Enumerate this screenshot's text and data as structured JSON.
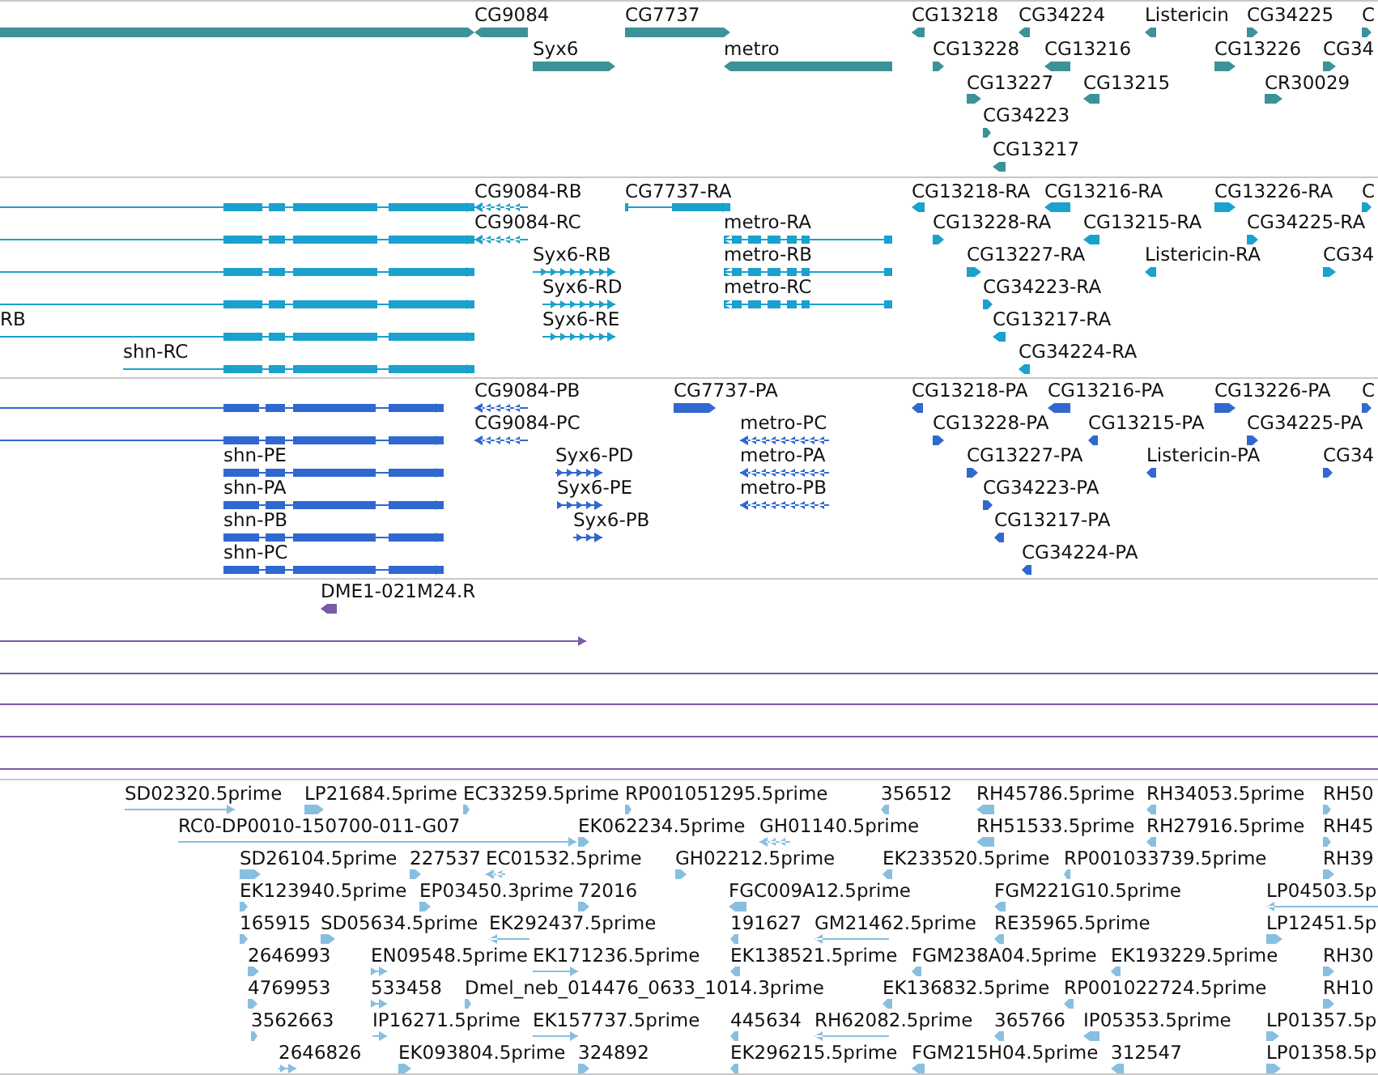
{
  "tracks": [
    {
      "color": "#3c9299",
      "features": [
        {
          "kind": "forward"
        },
        {
          "label": "CG9084",
          "kind": "reverse"
        },
        {
          "label": "CG7737",
          "kind": "forward"
        },
        {
          "label": "CG13218",
          "kind": "reverse"
        },
        {
          "label": "CG34224",
          "kind": "reverse"
        },
        {
          "label": "Listericin",
          "kind": "reverse"
        },
        {
          "label": "CG34225",
          "kind": "forward"
        },
        {
          "label": "C",
          "kind": "forward"
        },
        {
          "label": "Syx6",
          "kind": "forward"
        },
        {
          "label": "metro",
          "kind": "reverse"
        },
        {
          "label": "CG13228",
          "kind": "forward"
        },
        {
          "label": "CG13216",
          "kind": "reverse"
        },
        {
          "label": "CG13226",
          "kind": "forward"
        },
        {
          "label": "CG34",
          "kind": "forward"
        },
        {
          "label": "CG13227",
          "kind": "forward"
        },
        {
          "label": "CG13215",
          "kind": "reverse"
        },
        {
          "label": "CR30029",
          "kind": "forward"
        },
        {
          "label": "CG34223",
          "kind": "forward"
        },
        {
          "label": "CG13217",
          "kind": "reverse"
        }
      ]
    },
    {
      "color": "#1ba1cd",
      "features": [
        {
          "kind": "forward"
        },
        {
          "label": "CG9084-RB",
          "kind": "reverse"
        },
        {
          "label": "CG7737-RA",
          "kind": "forward"
        },
        {
          "label": "CG13218-RA",
          "kind": "reverse"
        },
        {
          "label": "CG13216-RA",
          "kind": "reverse"
        },
        {
          "label": "CG13226-RA",
          "kind": "forward"
        },
        {
          "label": "C",
          "kind": "forward"
        },
        {
          "kind": "forward"
        },
        {
          "label": "CG9084-RC",
          "kind": "reverse"
        },
        {
          "label": "metro-RA",
          "kind": "reverse"
        },
        {
          "label": "CG13228-RA",
          "kind": "forward"
        },
        {
          "label": "CG13215-RA",
          "kind": "reverse"
        },
        {
          "label": "CG34225-RA",
          "kind": "forward"
        },
        {
          "kind": "forward"
        },
        {
          "label": "Syx6-RB",
          "kind": "forward"
        },
        {
          "label": "metro-RB",
          "kind": "reverse"
        },
        {
          "label": "CG13227-RA",
          "kind": "forward"
        },
        {
          "label": "Listericin-RA",
          "kind": "reverse"
        },
        {
          "label": "CG34",
          "kind": "forward"
        },
        {
          "kind": "forward"
        },
        {
          "label": "Syx6-RD",
          "kind": "forward"
        },
        {
          "label": "metro-RC",
          "kind": "reverse"
        },
        {
          "label": "CG34223-RA",
          "kind": "forward"
        },
        {
          "label": "RB",
          "kind": "forward"
        },
        {
          "label": "Syx6-RE",
          "kind": "forward"
        },
        {
          "label": "CG13217-RA",
          "kind": "reverse"
        },
        {
          "label": "shn-RC",
          "kind": "forward"
        },
        {
          "label": "CG34224-RA",
          "kind": "reverse"
        }
      ]
    },
    {
      "color": "#3068d0",
      "features": [
        {
          "kind": "forward"
        },
        {
          "label": "CG9084-PB",
          "kind": "reverse"
        },
        {
          "label": "CG7737-PA",
          "kind": "forward"
        },
        {
          "label": "CG13218-PA",
          "kind": "reverse"
        },
        {
          "label": "CG13216-PA",
          "kind": "reverse"
        },
        {
          "label": "CG13226-PA",
          "kind": "forward"
        },
        {
          "label": "C",
          "kind": "forward"
        },
        {
          "kind": "forward"
        },
        {
          "label": "CG9084-PC",
          "kind": "reverse"
        },
        {
          "label": "metro-PC",
          "kind": "reverse"
        },
        {
          "label": "CG13228-PA",
          "kind": "forward"
        },
        {
          "label": "CG13215-PA",
          "kind": "reverse"
        },
        {
          "label": "CG34225-PA",
          "kind": "forward"
        },
        {
          "label": "shn-PE",
          "kind": "forward"
        },
        {
          "label": "Syx6-PD",
          "kind": "forward"
        },
        {
          "label": "metro-PA",
          "kind": "reverse"
        },
        {
          "label": "CG13227-PA",
          "kind": "forward"
        },
        {
          "label": "Listericin-PA",
          "kind": "reverse"
        },
        {
          "label": "CG34",
          "kind": "forward"
        },
        {
          "label": "shn-PA",
          "kind": "forward"
        },
        {
          "label": "Syx6-PE",
          "kind": "forward"
        },
        {
          "label": "metro-PB",
          "kind": "reverse"
        },
        {
          "label": "CG34223-PA",
          "kind": "forward"
        },
        {
          "label": "shn-PB",
          "kind": "forward"
        },
        {
          "label": "Syx6-PB",
          "kind": "forward"
        },
        {
          "label": "CG13217-PA",
          "kind": "reverse"
        },
        {
          "label": "shn-PC",
          "kind": "forward"
        },
        {
          "label": "CG34224-PA",
          "kind": "reverse"
        }
      ]
    },
    {
      "color": "#7b5aa6",
      "features": [
        {
          "label": "DME1-021M24.R",
          "kind": "reverse"
        },
        {
          "kind": "forward"
        },
        {
          "kind": "plain"
        },
        {
          "kind": "plain"
        },
        {
          "kind": "plain"
        },
        {
          "kind": "plain"
        }
      ]
    },
    {
      "color": "#88bfe0",
      "features": [
        {
          "label": "SD02320.5prime",
          "kind": "forward"
        },
        {
          "label": "LP21684.5prime",
          "kind": "forward"
        },
        {
          "label": "EC33259.5prime",
          "kind": "forward"
        },
        {
          "label": "RP001051295.5prime",
          "kind": "forward"
        },
        {
          "label": "356512",
          "kind": "reverse"
        },
        {
          "label": "RH45786.5prime",
          "kind": "reverse"
        },
        {
          "label": "RH34053.5prime",
          "kind": "reverse"
        },
        {
          "label": "RH50",
          "kind": "forward"
        },
        {
          "label": "RC0-DP0010-150700-011-G07",
          "kind": "forward"
        },
        {
          "label": "EK062234.5prime",
          "kind": "forward"
        },
        {
          "label": "GH01140.5prime",
          "kind": "reverse"
        },
        {
          "label": "RH51533.5prime",
          "kind": "reverse"
        },
        {
          "label": "RH27916.5prime",
          "kind": "reverse"
        },
        {
          "label": "RH45",
          "kind": "forward"
        },
        {
          "label": "SD26104.5prime",
          "kind": "forward"
        },
        {
          "label": "227537",
          "kind": "forward"
        },
        {
          "label": "EC01532.5prime",
          "kind": "reverse"
        },
        {
          "label": "GH02212.5prime",
          "kind": "forward"
        },
        {
          "label": "EK233520.5prime",
          "kind": "reverse"
        },
        {
          "label": "RP001033739.5prime",
          "kind": "reverse"
        },
        {
          "label": "RH39",
          "kind": "forward"
        },
        {
          "label": "EK123940.5prime",
          "kind": "forward"
        },
        {
          "label": "EP03450.3prime",
          "kind": "forward"
        },
        {
          "label": "72016",
          "kind": "forward"
        },
        {
          "label": "FGC009A12.5prime",
          "kind": "reverse"
        },
        {
          "label": "FGM221G10.5prime",
          "kind": "reverse"
        },
        {
          "label": "LP04503.5p",
          "kind": "reverse"
        },
        {
          "label": "165915",
          "kind": "forward"
        },
        {
          "label": "SD05634.5prime",
          "kind": "forward"
        },
        {
          "label": "EK292437.5prime",
          "kind": "reverse"
        },
        {
          "label": "191627",
          "kind": "reverse"
        },
        {
          "label": "GM21462.5prime",
          "kind": "reverse"
        },
        {
          "label": "RE35965.5prime",
          "kind": "reverse"
        },
        {
          "label": "LP12451.5p",
          "kind": "forward"
        },
        {
          "label": "2646993",
          "kind": "forward"
        },
        {
          "label": "EN09548.5prime",
          "kind": "forward"
        },
        {
          "label": "EK171236.5prime",
          "kind": "forward"
        },
        {
          "label": "EK138521.5prime",
          "kind": "reverse"
        },
        {
          "label": "FGM238A04.5prime",
          "kind": "reverse"
        },
        {
          "label": "EK193229.5prime",
          "kind": "reverse"
        },
        {
          "label": "RH30",
          "kind": "forward"
        },
        {
          "label": "4769953",
          "kind": "forward"
        },
        {
          "label": "533458",
          "kind": "forward"
        },
        {
          "label": "Dmel_neb_014476_0633_1014.3prime",
          "kind": "forward"
        },
        {
          "label": "EK136832.5prime",
          "kind": "reverse"
        },
        {
          "label": "RP001022724.5prime",
          "kind": "reverse"
        },
        {
          "label": "RH10",
          "kind": "forward"
        },
        {
          "label": "3562663",
          "kind": "forward"
        },
        {
          "label": "IP16271.5prime",
          "kind": "forward"
        },
        {
          "label": "EK157737.5prime",
          "kind": "forward"
        },
        {
          "label": "445634",
          "kind": "reverse"
        },
        {
          "label": "RH62082.5prime",
          "kind": "reverse"
        },
        {
          "label": "365766",
          "kind": "reverse"
        },
        {
          "label": "IP05353.5prime",
          "kind": "reverse"
        },
        {
          "label": "LP01357.5p",
          "kind": "forward"
        },
        {
          "label": "2646826",
          "kind": "forward"
        },
        {
          "label": "EK093804.5prime",
          "kind": "forward"
        },
        {
          "label": "324892",
          "kind": "forward"
        },
        {
          "label": "EK296215.5prime",
          "kind": "reverse"
        },
        {
          "label": "FGM215H04.5prime",
          "kind": "reverse"
        },
        {
          "label": "312547",
          "kind": "reverse"
        },
        {
          "label": "LP01358.5p",
          "kind": "forward"
        }
      ]
    }
  ]
}
